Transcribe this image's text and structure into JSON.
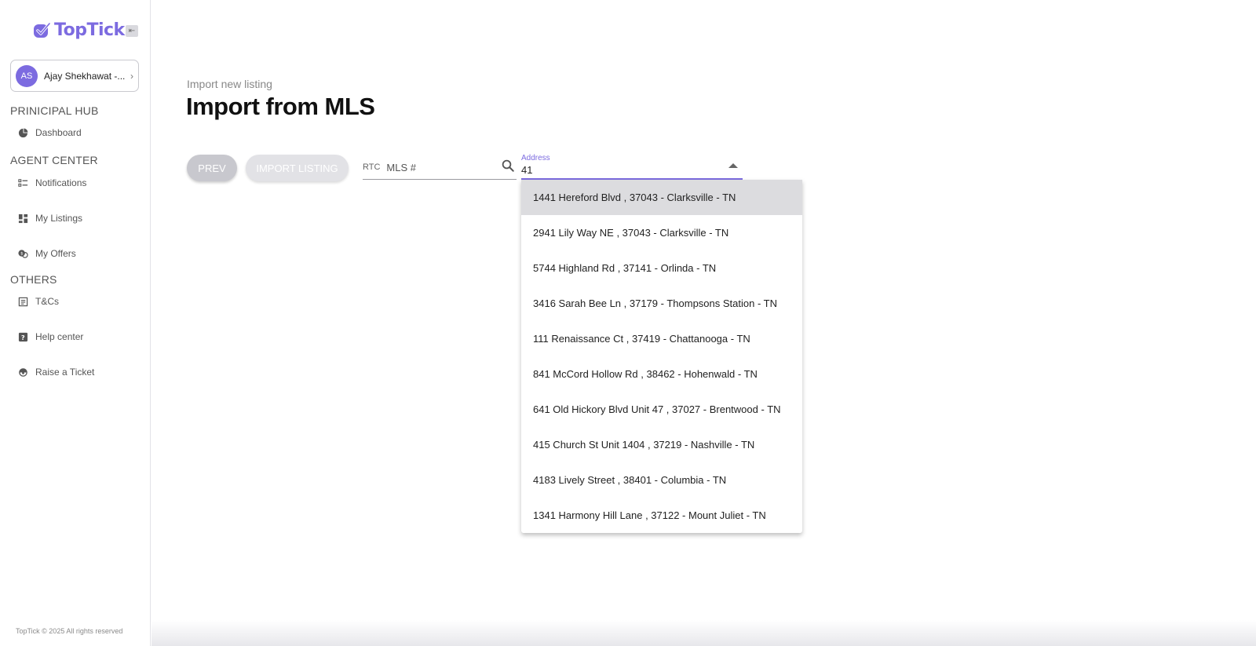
{
  "app": {
    "name": "TopTick",
    "brand_color": "#7c6be0"
  },
  "profile": {
    "initials": "AS",
    "name": "Ajay Shekhawat -..."
  },
  "sidebar": {
    "sections": [
      {
        "title": "PRINICIPAL HUB",
        "items": [
          {
            "label": "Dashboard",
            "icon": "pie-chart-icon"
          }
        ]
      },
      {
        "title": "AGENT CENTER",
        "items": [
          {
            "label": "Notifications",
            "icon": "list-icon"
          },
          {
            "label": "My Listings",
            "icon": "grid-icon"
          },
          {
            "label": "My Offers",
            "icon": "offers-icon"
          }
        ]
      },
      {
        "title": "OTHERS",
        "items": [
          {
            "label": "T&Cs",
            "icon": "document-icon"
          },
          {
            "label": "Help center",
            "icon": "help-icon"
          },
          {
            "label": "Raise a Ticket",
            "icon": "support-icon"
          }
        ]
      }
    ],
    "footer": "TopTick © 2025 All rights reserved"
  },
  "page": {
    "breadcrumb": "Import new listing",
    "title": "Import from MLS",
    "prev_label": "PREV",
    "import_label": "IMPORT LISTING"
  },
  "mls": {
    "prefix": "RTC",
    "placeholder": "MLS #",
    "value": ""
  },
  "address": {
    "label": "Address",
    "value": "41",
    "options": [
      "1441 Hereford Blvd , 37043 - Clarksville - TN",
      "2941 Lily Way NE , 37043 - Clarksville - TN",
      "5744 Highland Rd , 37141 - Orlinda - TN",
      "3416 Sarah Bee Ln , 37179 - Thompsons Station - TN",
      "111 Renaissance Ct , 37419 - Chattanooga - TN",
      "841 McCord Hollow Rd , 38462 - Hohenwald - TN",
      "641 Old Hickory Blvd Unit 47 , 37027 - Brentwood - TN",
      "415 Church St Unit 1404 , 37219 - Nashville - TN",
      "4183 Lively Street , 38401 - Columbia - TN",
      "1341 Harmony Hill Lane , 37122 - Mount Juliet - TN"
    ],
    "highlighted_index": 0
  }
}
